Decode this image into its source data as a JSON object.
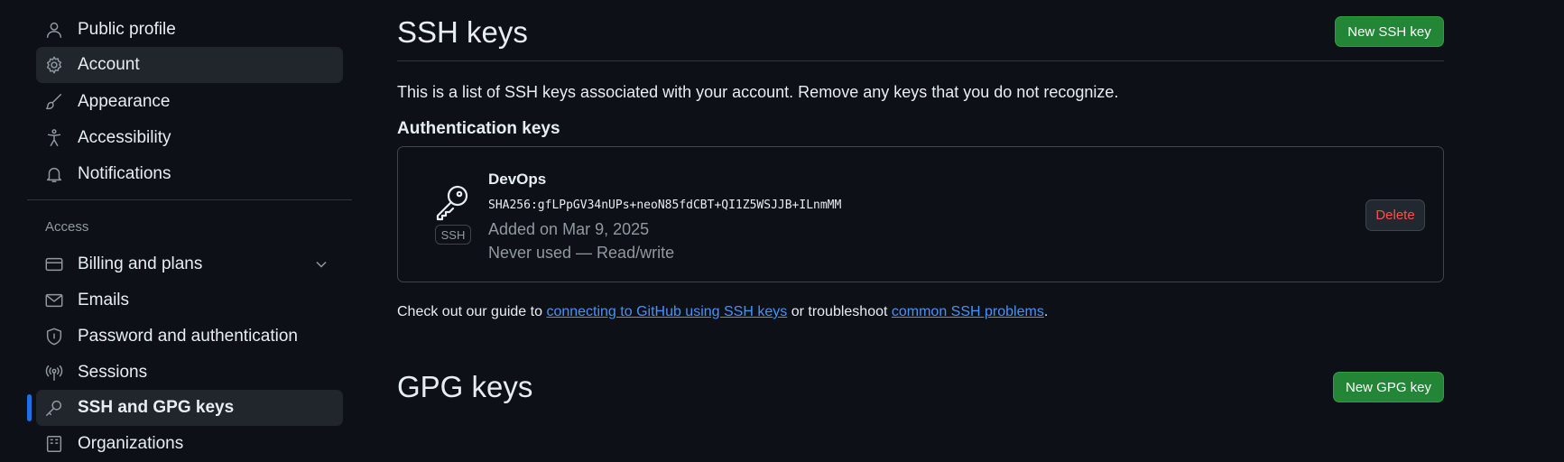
{
  "sidebar": {
    "items": [
      {
        "label": "Public profile",
        "icon": "person-icon"
      },
      {
        "label": "Account",
        "icon": "gear-icon"
      },
      {
        "label": "Appearance",
        "icon": "paintbrush-icon"
      },
      {
        "label": "Accessibility",
        "icon": "accessibility-icon"
      },
      {
        "label": "Notifications",
        "icon": "bell-icon"
      }
    ],
    "section_label": "Access",
    "access_items": [
      {
        "label": "Billing and plans",
        "icon": "credit-card-icon"
      },
      {
        "label": "Emails",
        "icon": "mail-icon"
      },
      {
        "label": "Password and authentication",
        "icon": "shield-lock-icon"
      },
      {
        "label": "Sessions",
        "icon": "broadcast-icon"
      },
      {
        "label": "SSH and GPG keys",
        "icon": "key-icon"
      }
    ],
    "partial_item_label": "Organizations"
  },
  "ssh": {
    "title": "SSH keys",
    "new_button": "New SSH key",
    "description": "This is a list of SSH keys associated with your account. Remove any keys that you do not recognize.",
    "auth_heading": "Authentication keys",
    "keys": [
      {
        "title": "DevOps",
        "badge": "SSH",
        "fingerprint": "SHA256:gfLPpGV34nUPs+neoN85fdCBT+QI1Z5WSJJB+ILnmMM",
        "added": "Added on Mar 9, 2025",
        "usage": "Never used — Read/write",
        "delete_label": "Delete"
      }
    ],
    "guide": {
      "prefix": "Check out our guide to ",
      "link1": "connecting to GitHub using SSH keys",
      "middle": " or troubleshoot ",
      "link2": "common SSH problems",
      "suffix": "."
    }
  },
  "gpg": {
    "title": "GPG keys",
    "new_button": "New GPG key"
  },
  "colors": {
    "background": "#0d1117",
    "accent_blue": "#1f6feb",
    "link": "#4493f8",
    "green_button": "#238636",
    "danger": "#f85149"
  }
}
